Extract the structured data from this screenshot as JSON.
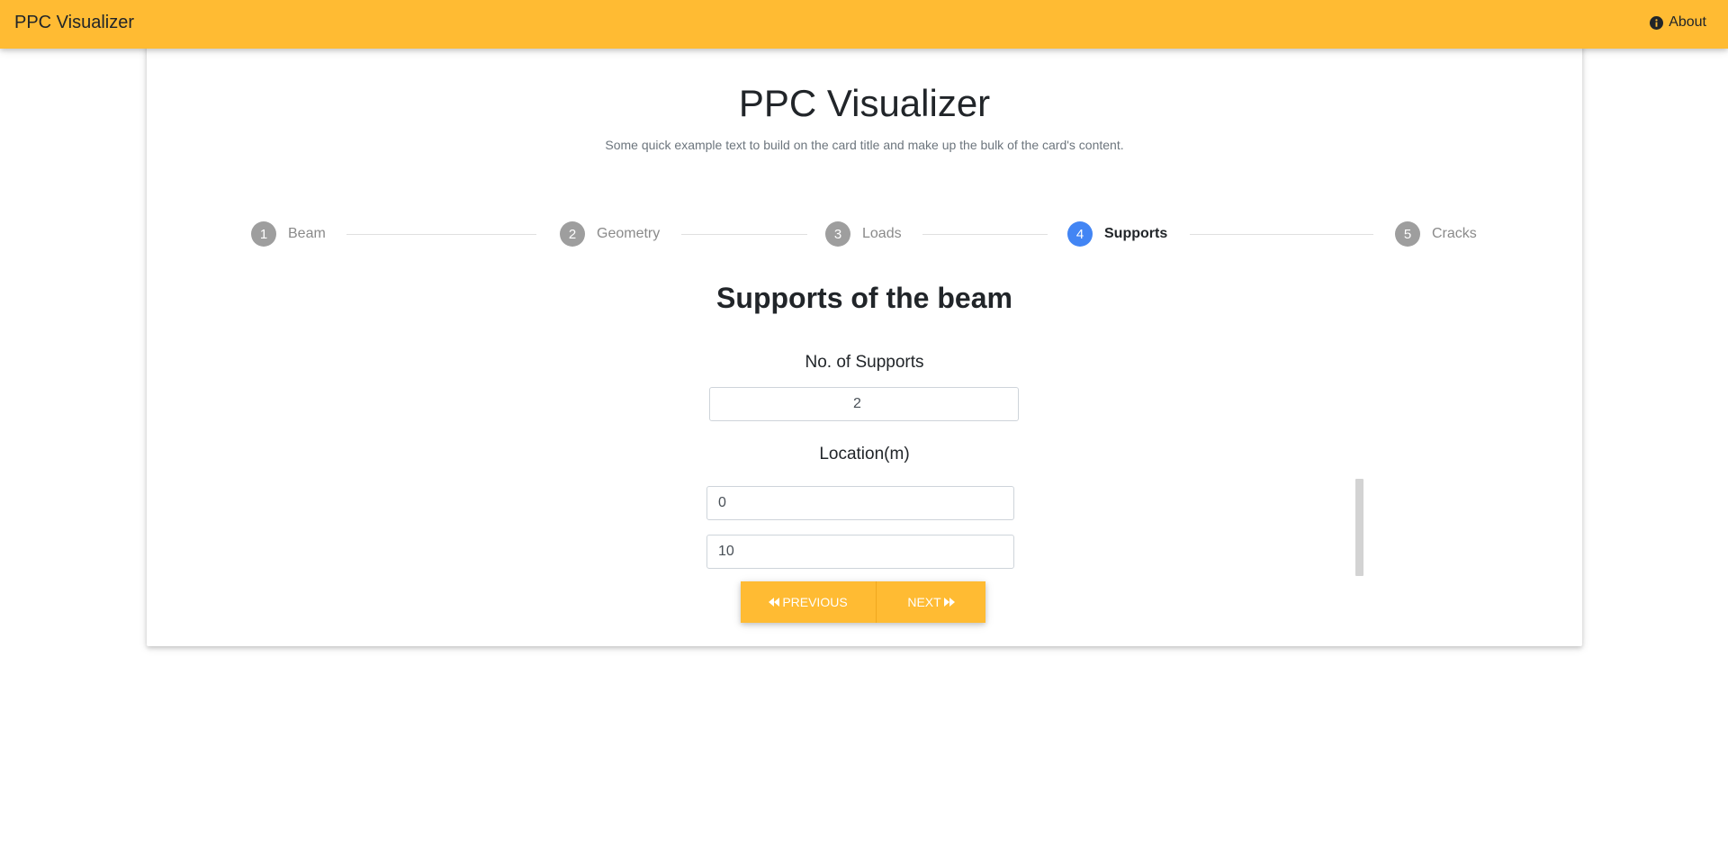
{
  "navbar": {
    "brand": "PPC Visualizer",
    "about_label": "About",
    "color": "#FFBB33"
  },
  "card": {
    "title": "PPC Visualizer",
    "text": "Some quick example text to build on the card title and make up the bulk of the card's content."
  },
  "stepper": {
    "steps": [
      {
        "number": "1",
        "label": "Beam",
        "active": false
      },
      {
        "number": "2",
        "label": "Geometry",
        "active": false
      },
      {
        "number": "3",
        "label": "Loads",
        "active": false
      },
      {
        "number": "4",
        "label": "Supports",
        "active": true
      },
      {
        "number": "5",
        "label": "Cracks",
        "active": false
      }
    ],
    "active_color": "#4285F4",
    "inactive_color": "#9e9e9e"
  },
  "supports": {
    "title": "Supports of the beam",
    "count_label": "No. of Supports",
    "count_value": "2",
    "location_label": "Location(m)",
    "locations": [
      "0",
      "10"
    ]
  },
  "buttons": {
    "previous": "PREVIOUS",
    "next": "NEXT"
  },
  "icons": {
    "about": "info-circle-icon",
    "previous": "backward-icon",
    "next": "forward-icon"
  }
}
